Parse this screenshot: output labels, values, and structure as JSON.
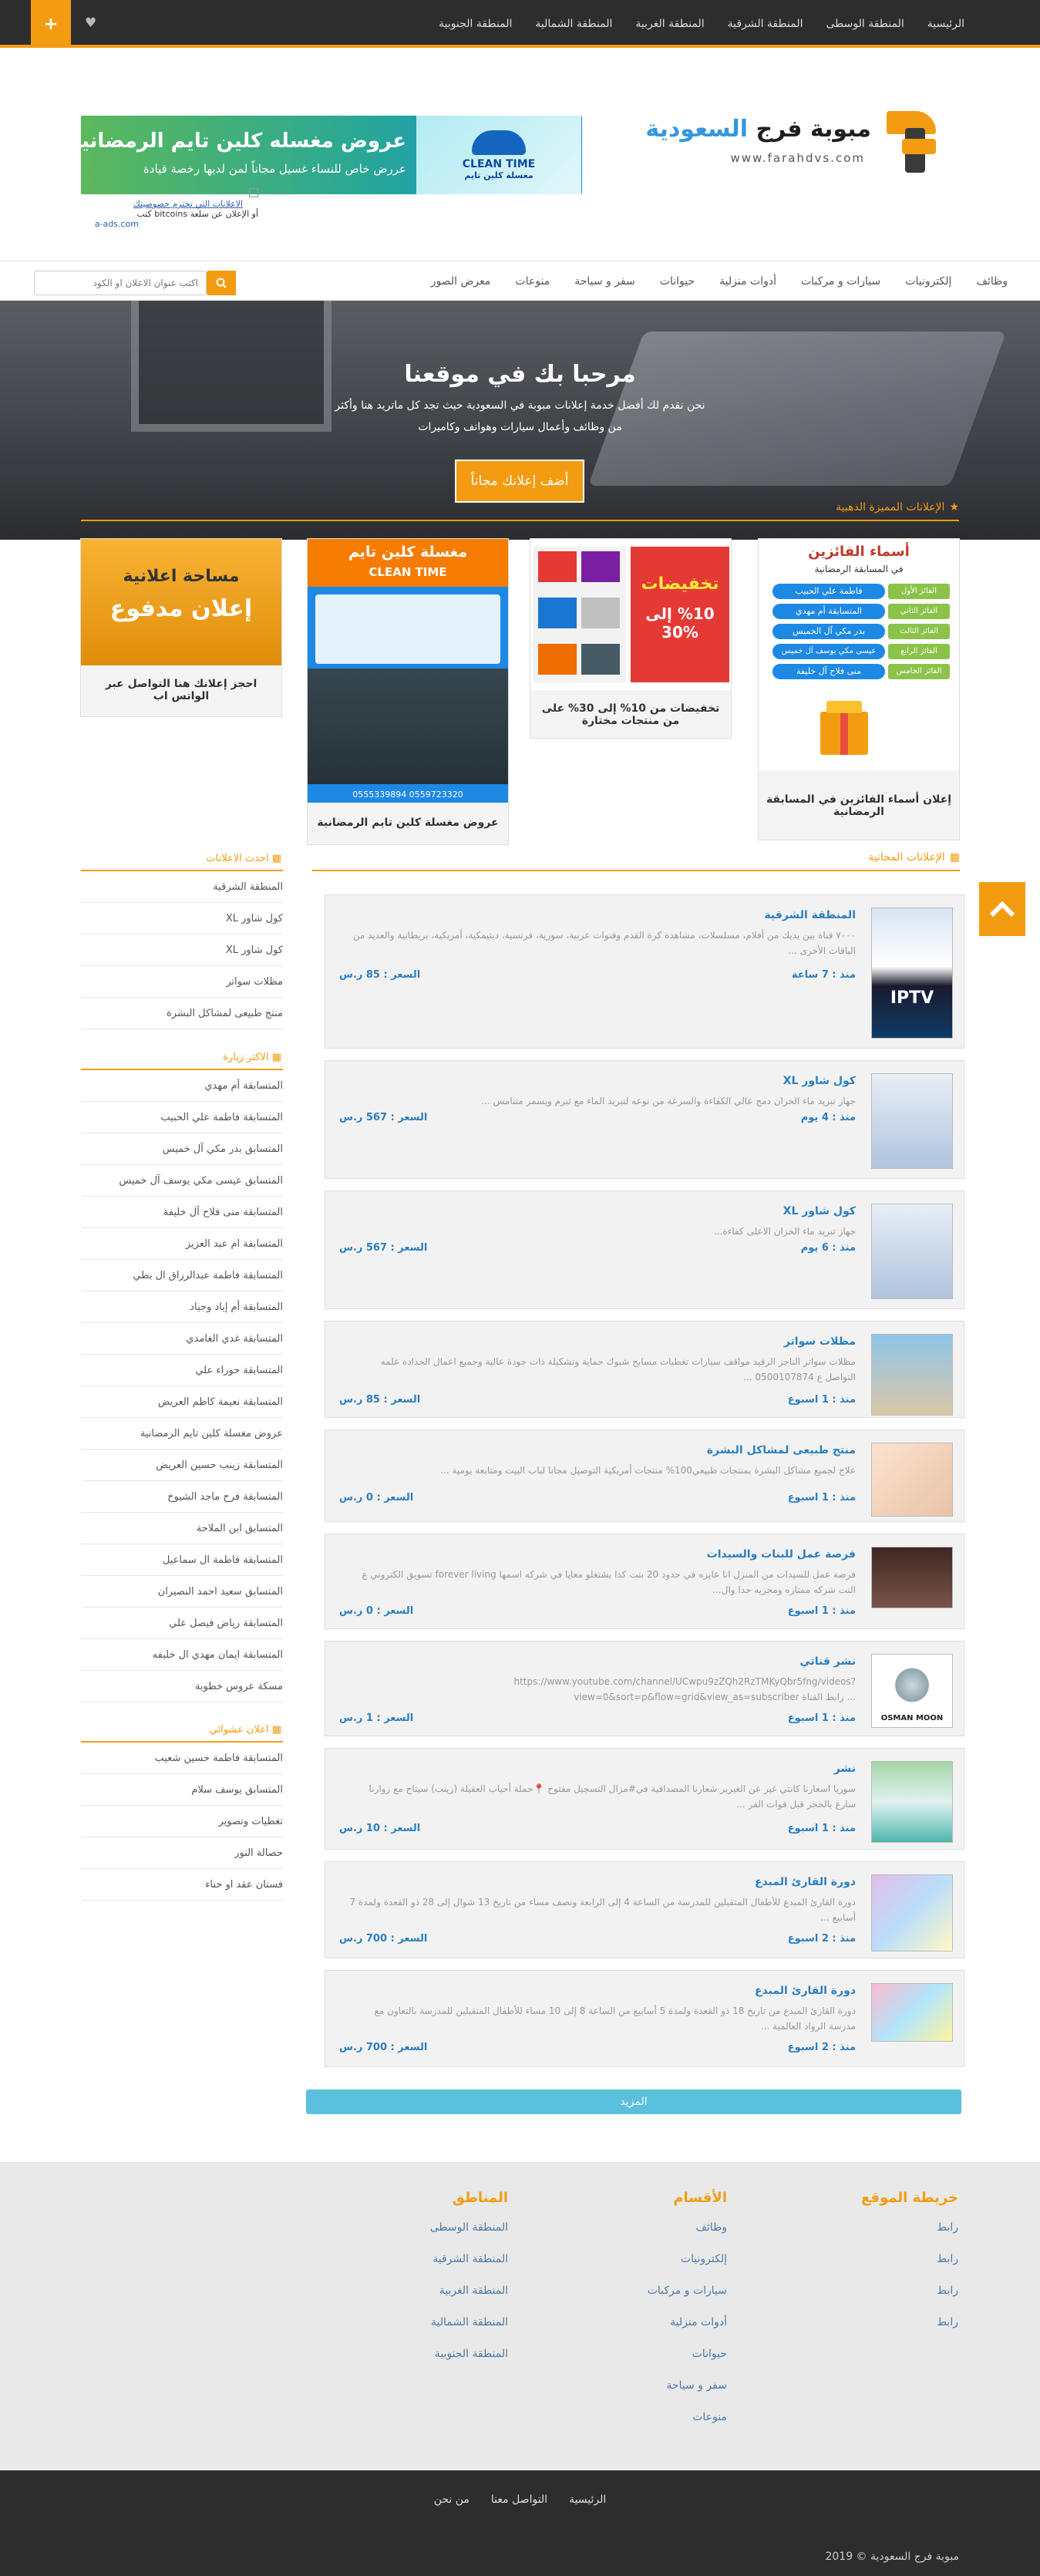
{
  "topnav": {
    "items": [
      "الرئيسية",
      "المنطقة الوسطى",
      "المنطقة الشرقية",
      "المنطقة الغربية",
      "المنطقة الشمالية",
      "المنطقة الجنوبية"
    ],
    "plus": "+",
    "heart": "♥"
  },
  "header": {
    "logo_main": "مبوبة فرج",
    "logo_accent": "السعودية",
    "logo_url": "www.farahdvs.com",
    "banner_title": "عروض مغسله كلين تايم الرمضانية",
    "banner_sub": "عررض خاص للنساء غسيل مجاناً لمن لديها رخصة قيادة",
    "banner_brand": "CLEAN TIME",
    "banner_brand_ar": "مغسلة كلين تايم",
    "ad_link1": "الاعلانات التي تحترم خصوصيتك",
    "ad_link2": "أو الإعلان عن سلعة bitcoins كتب",
    "ad_link3": "a-ads.com"
  },
  "mainnav": {
    "items": [
      "وظائف",
      "إلكترونيات",
      "سيارات و مركبات",
      "أدوات منزلية",
      "حيوانات",
      "سفر و سياحة",
      "منوعات",
      "معرض الصور"
    ],
    "search_placeholder": "اكتب عنوان الاعلان او الكود"
  },
  "hero": {
    "title": "مرحبا بك في موقعنا",
    "line1": "نحن نقدم لك أفضل خدمة إعلانات مبوبة في السعودية حيث تجد كل ماتريد هنا وأكثر",
    "line2": "من وظائف وأعمال سيارات وهواتف وكاميرات",
    "cta": "أضف إعلانك مجاناً"
  },
  "featured": {
    "title": "الإعلانات المميزة الذهبية",
    "cards": [
      {
        "caption": "إعلان أسماء الفائزين في المسابقة الرمضانية",
        "img_title": "أسماء الفائزين",
        "img_sub": "في المسابقة الرمضانية",
        "winners": [
          "فاطمة علي الحبيب",
          "المتسابقة أم مهدي",
          "بدر مكي آل الخميس",
          "عيسى مكي يوسف آل خميس",
          "منى فلاح آل خليفة"
        ],
        "places": [
          "الفائز الأول",
          "الفائز الثاني",
          "الفائز الثالث",
          "الفائز الرابع",
          "الفائز الخامس"
        ]
      },
      {
        "caption": "تخفيضات من 10% إلى 30% على من منتجات مختارة",
        "img_title": "تخفيضات",
        "img_pct": "%10 إلى %30"
      },
      {
        "caption": "عروض مغسلة كلين تايم الرمضانية",
        "img_title": "مغسلة كلين تايم",
        "img_brand": "CLEAN TIME",
        "img_phone": "0559723320 0555339894"
      },
      {
        "caption": "احجز إعلانك هنا التواصل عبر الواتس اب",
        "img_title": "مساحة اعلانية",
        "img_sub": "إعلان مدفوع"
      }
    ]
  },
  "sidebar": {
    "latest_title": "احدث الاعلانات",
    "latest": [
      "المنطقة الشرقية",
      "كول شاور XL",
      "كول شاور XL",
      "مظلات سواتر",
      "منتج طبيعى لمشاكل البشرة"
    ],
    "visited_title": "الاكثر زيارة",
    "visited": [
      "المتسابقة أم مهدي",
      "المتسابقة فاطمة علي الحبيب",
      "المتسابق بدر مكي آل خميس",
      "المتسابق عيسى مكي يوسف آل خميس",
      "المتسابقة منى فلاح آل خليفة",
      "المتسابقة ام عبد العزيز",
      "المتسابقة فاطمة عبدالرزاق ال بطي",
      "المتسابقة أم إياد وجياد",
      "المتسابقة غدي الغامدي",
      "المتسابقة حوراء علي",
      "المتسابقة نعيمة كاظم العريض",
      "عروض مغسلة كلين تايم الرمضانية",
      "المتسابقة زينب حسين العريض",
      "المتسابقة فرح ماجد الشيوخ",
      "المتسابق ابن الملاحة",
      "المتسابقة فاطمة ال سماعيل",
      "المتسابق سعيد احمد النصيران",
      "المتسابقة رياض فيصل علي",
      "المتسابقة ايمان مهدي ال خليفه",
      "مسكة عروس خطوبة"
    ],
    "random_title": "اعلان عشوائي",
    "random": [
      "المتسابقة فاطمة حسين شعيب",
      "المتسابق يوسف سلام",
      "تغطيات وتصوير",
      "حصالة النور",
      "فستان عقد او حناء"
    ]
  },
  "listings": {
    "title": "الإعلانات المجانية",
    "since_label": "منذ :",
    "price_label": "السعر :",
    "items": [
      {
        "title": "المنطقة الشرقية",
        "desc": "٧٠٠٠ قناة بين يديك من أفلام، مسلسلات، مشاهدة كرة القدم وقنوات عربية، سورية، فرنسية، ديتيمكية، أمريكية، بريطانية والعديد من الباقات الأخرى ...",
        "since": "7 ساعة",
        "price": "85 ر.س",
        "thumb": "IPTV"
      },
      {
        "title": "كول شاور XL",
        "desc": "جهاز تبريد ماء الخزان دمج عالي الكفاءة والسرعة من نوعه لتبريد الماء مع ثيرم ويسمر متنامس ...",
        "since": "4 يوم",
        "price": "567 ر.س",
        "thumb": ""
      },
      {
        "title": "كول شاور XL",
        "desc": "جهاز تبريد ماء الخزان الاعلى كفاءة...",
        "since": "6 يوم",
        "price": "567 ر.س",
        "thumb": ""
      },
      {
        "title": "مظلات سواتر",
        "desc": "مظلات سواتر الناجز الرفيد مواقف سيارات تغطيات مسابح شبوك حماية وتشكيلة ذات جودة عالية وجميع اعمال الحداده علمه التواصل ع 0500107874 ...",
        "since": "1 اسبوع",
        "price": "85 ر.س",
        "thumb": ""
      },
      {
        "title": "منتج طبيعى لمشاكل البشرة",
        "desc": "علاج لجميع مشاكل البشرة بمنتجات طبيعي100% منتجات أمريكية التوصيل مجانا لباب البيت ومتابعة يومية ...",
        "since": "1 اسبوع",
        "price": "0 ر.س",
        "thumb": ""
      },
      {
        "title": "فرصة عمل للبنات والسيدات",
        "desc": "فرصة عمل للسيدات من المنزل انا عايزه في حدود 20 بنت كدا يشتغلو معايا في شركه اسمها forever living تسويق الكتروني ع النت شركه ممتازه ومجزيه جدا وال...",
        "since": "1 اسبوع",
        "price": "0 ر.س",
        "thumb": ""
      },
      {
        "title": "نشر قناتي",
        "desc": "https://www.youtube.com/channel/UCwpu9zZQh2RzTMKyQbr5fng/videos?view=0&sort=p&flow=grid&view_as=subscriber رابط القناة ...",
        "since": "1 اسبوع",
        "price": "1 ر.س",
        "thumb": "OSMAN MOON"
      },
      {
        "title": "نشر",
        "desc": "سوريا اسعارنا كانتي غير عن الغيرير شعارنا المصداقية في#مزال التسجيل مفتوح 📍حملة أحباب العقيلة (زينب) سيتاح مع زوارنا سارع بالحجز قبل فوات الفر ...",
        "since": "1 اسبوع",
        "price": "10 ر.س",
        "thumb": ""
      },
      {
        "title": "دورة القارئ المبدع",
        "desc": "دورة القارئ المبدع للأطفال المتقبلين للمدرسة من الساعة 4 إلى الرابعة ونصف مساء من تاريخ 13 شوال إلى 28 ذو القعدة ولمدة 7 أسابيع ...",
        "since": "2 اسبوع",
        "price": "700 ر.س",
        "thumb": ""
      },
      {
        "title": "دورة القارئ المبدع",
        "desc": "دورة القارئ المبدع من تاريخ 18 ذو القعدة ولمدة 5 أسابيع من الساعة 8 إلى 10 مساء للأطفال المتقبلين للمدرسة بالتعاون مع مدرسة الرواد العالمية ...",
        "since": "2 اسبوع",
        "price": "700 ر.س",
        "thumb": ""
      }
    ],
    "more": "المزيد"
  },
  "footer": {
    "sitemap_title": "خريطة الموقع",
    "sitemap": [
      "رابط",
      "رابط",
      "رابط",
      "رابط"
    ],
    "categories_title": "الأقسام",
    "categories": [
      "وظائف",
      "إلكترونيات",
      "سيارات و مركبات",
      "أدوات منزلية",
      "حيوانات",
      "سفر و سياحة",
      "منوعات"
    ],
    "regions_title": "المناطق",
    "regions": [
      "المنطقة الوسطى",
      "المنطقة الشرقية",
      "المنطقة الغربية",
      "المنطقة الشمالية",
      "المنطقة الجنوبية"
    ],
    "links": [
      "الرئيسية",
      "التواصل معنا",
      "من نحن"
    ],
    "copyright": "مبوبة فرج السعودية © 2019"
  },
  "colors": {
    "accent": "#f39c12",
    "dark": "#2d2d2d",
    "link": "#2c7fbf",
    "button": "#5bc0de"
  }
}
